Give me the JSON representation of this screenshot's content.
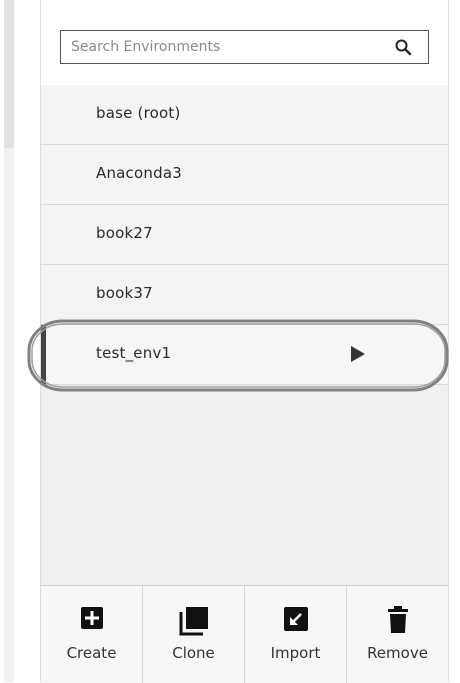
{
  "search": {
    "placeholder": "Search Environments",
    "value": ""
  },
  "environments": [
    {
      "label": "base (root)",
      "active": false
    },
    {
      "label": "Anaconda3",
      "active": false
    },
    {
      "label": "book27",
      "active": false
    },
    {
      "label": "book37",
      "active": false
    },
    {
      "label": "test_env1",
      "active": true
    }
  ],
  "toolbar": {
    "create_label": "Create",
    "clone_label": "Clone",
    "import_label": "Import",
    "remove_label": "Remove"
  },
  "icons": {
    "search": "search-icon",
    "play": "play-icon",
    "create": "plus-square-icon",
    "clone": "clone-icon",
    "import": "import-arrow-icon",
    "remove": "trash-icon"
  },
  "colors": {
    "active_bar": "#444444",
    "highlight": "#808080"
  }
}
